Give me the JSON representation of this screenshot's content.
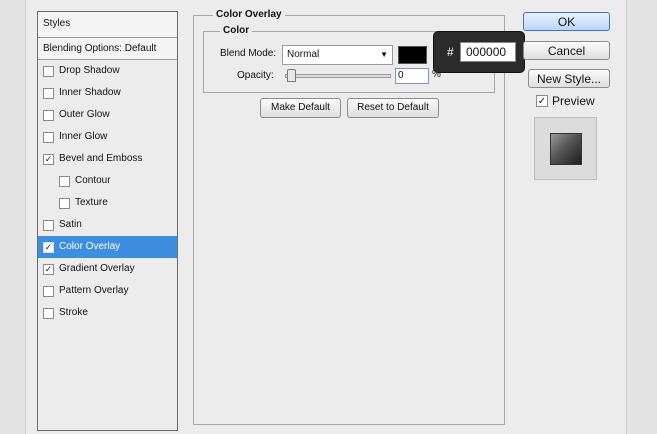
{
  "styles_panel": {
    "header": "Styles",
    "blending_default": "Blending Options: Default",
    "items": [
      {
        "label": "Drop Shadow",
        "checked": false,
        "sub": false,
        "active": false
      },
      {
        "label": "Inner Shadow",
        "checked": false,
        "sub": false,
        "active": false
      },
      {
        "label": "Outer Glow",
        "checked": false,
        "sub": false,
        "active": false
      },
      {
        "label": "Inner Glow",
        "checked": false,
        "sub": false,
        "active": false
      },
      {
        "label": "Bevel and Emboss",
        "checked": true,
        "sub": false,
        "active": false
      },
      {
        "label": "Contour",
        "checked": false,
        "sub": true,
        "active": false
      },
      {
        "label": "Texture",
        "checked": false,
        "sub": true,
        "active": false
      },
      {
        "label": "Satin",
        "checked": false,
        "sub": false,
        "active": false
      },
      {
        "label": "Color Overlay",
        "checked": true,
        "sub": false,
        "active": true
      },
      {
        "label": "Gradient Overlay",
        "checked": true,
        "sub": false,
        "active": false
      },
      {
        "label": "Pattern Overlay",
        "checked": false,
        "sub": false,
        "active": false
      },
      {
        "label": "Stroke",
        "checked": false,
        "sub": false,
        "active": false
      }
    ]
  },
  "color_overlay": {
    "title": "Color Overlay",
    "group_title": "Color",
    "blend_mode_label": "Blend Mode:",
    "blend_mode_value": "Normal",
    "swatch_color": "#000000",
    "opacity_label": "Opacity:",
    "opacity_value": "0",
    "opacity_unit": "%",
    "hex_hash": "#",
    "hex_value": "000000",
    "make_default_label": "Make Default",
    "reset_default_label": "Reset to Default"
  },
  "dialog_buttons": {
    "ok": "OK",
    "cancel": "Cancel",
    "new_style": "New Style..."
  },
  "preview": {
    "label": "Preview",
    "checked": true
  },
  "colors": {
    "active_item": "#3d8ee0",
    "panel_bg": "#ececec"
  }
}
